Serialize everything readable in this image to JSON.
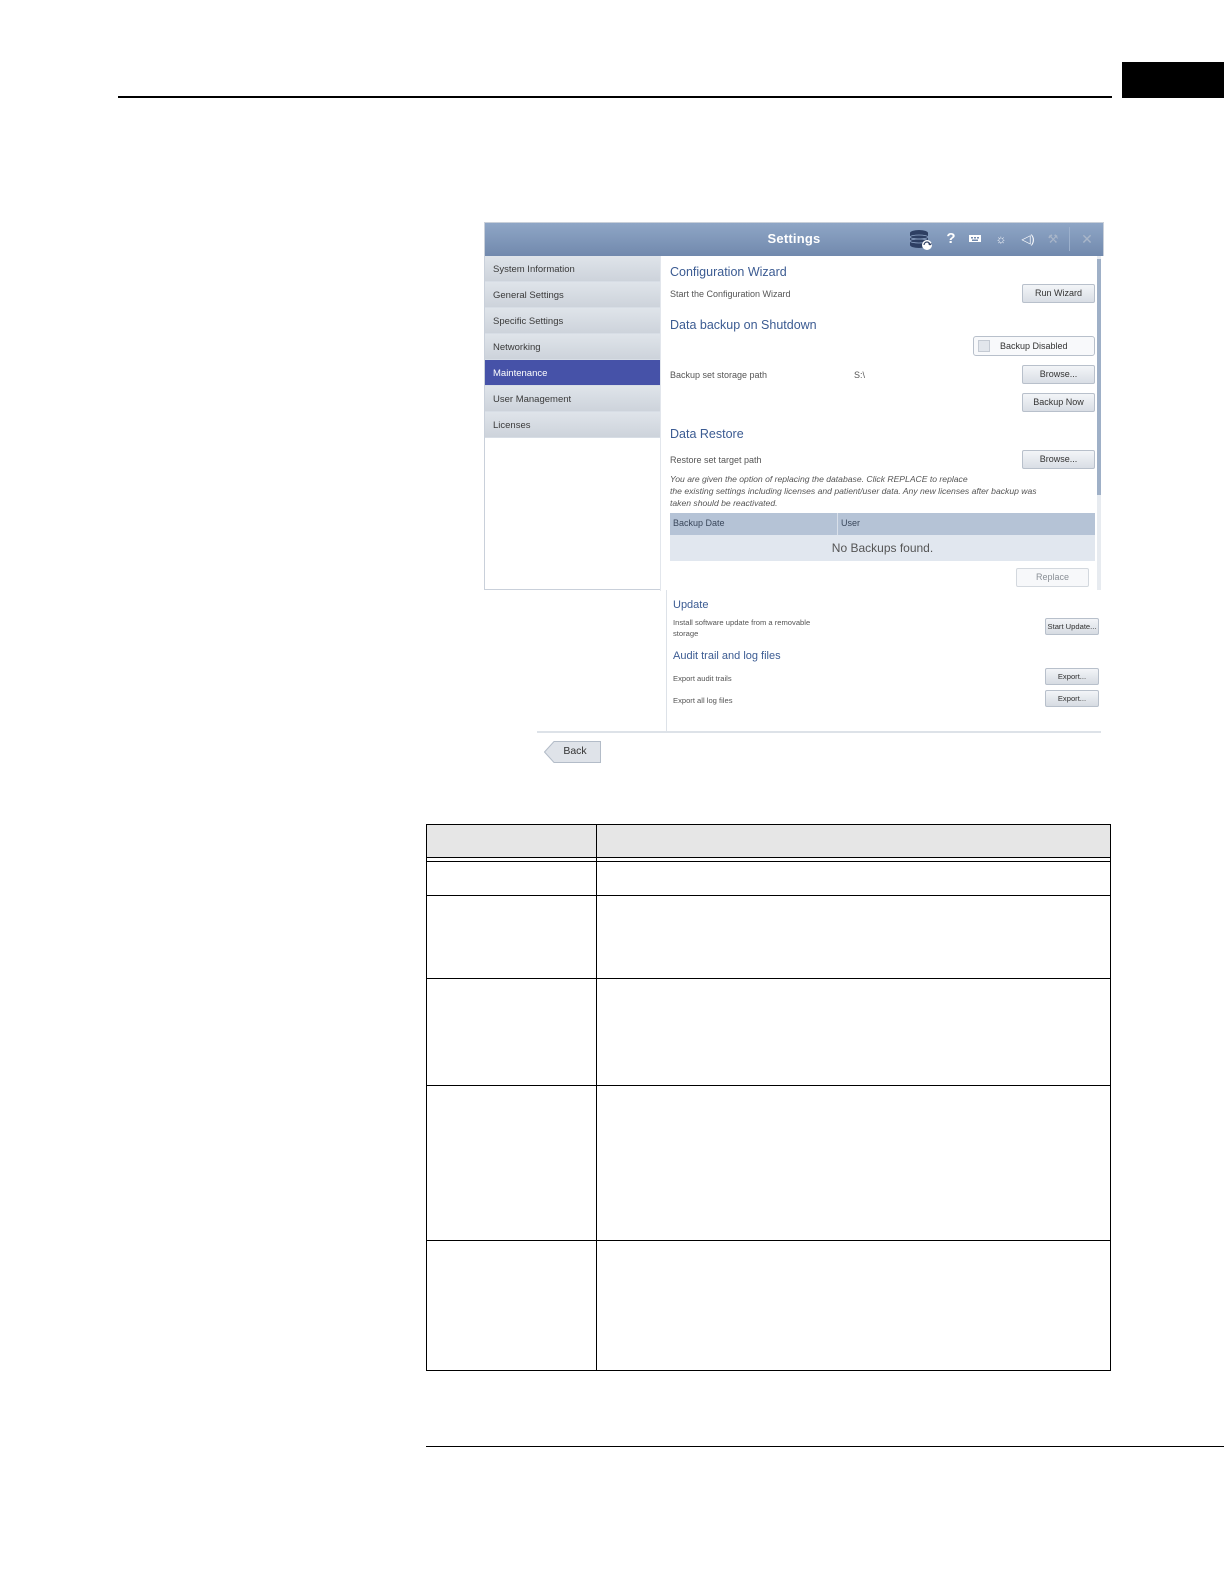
{
  "window": {
    "title": "Settings",
    "icons": [
      "database-sync-icon",
      "help-icon",
      "keyboard-icon",
      "brightness-icon",
      "volume-icon",
      "tool-icon",
      "close-icon"
    ],
    "help_glyph": "?"
  },
  "sidebar": {
    "items": [
      {
        "label": "System Information"
      },
      {
        "label": "General Settings"
      },
      {
        "label": "Specific Settings"
      },
      {
        "label": "Networking"
      },
      {
        "label": "Maintenance",
        "active": true
      },
      {
        "label": "User Management"
      },
      {
        "label": "Licenses"
      }
    ]
  },
  "config_wizard": {
    "heading": "Configuration Wizard",
    "label": "Start the Configuration Wizard",
    "button": "Run Wizard"
  },
  "backup": {
    "heading": "Data backup on Shutdown",
    "toggle_label": "Backup Disabled",
    "storage_path_label": "Backup set storage path",
    "storage_path_value": "S:\\",
    "browse_button": "Browse...",
    "backup_now_button": "Backup Now"
  },
  "restore": {
    "heading": "Data Restore",
    "target_path_label": "Restore set target path",
    "browse_button": "Browse...",
    "note_line1": "You are given the option of replacing the database. Click REPLACE to replace",
    "note_line2": "the existing settings including licenses and patient/user data. Any new licenses after backup was",
    "note_line3": "taken should be reactivated.",
    "table_headers": [
      "Backup Date",
      "User"
    ],
    "empty_text": "No Backups found.",
    "replace_button": "Replace"
  },
  "update": {
    "heading": "Update",
    "label_line1": "Install software update from a removable",
    "label_line2": "storage",
    "button": "Start Update..."
  },
  "audit": {
    "heading": "Audit trail and log files",
    "audit_label": "Export audit trails",
    "audit_button": "Export...",
    "log_label": "Export all log files",
    "log_button": "Export..."
  },
  "back_button": "Back",
  "colors": {
    "titlebar": "#7f97ba",
    "active_nav": "#4652a8",
    "heading": "#3b5b92",
    "table_header": "#b5c3d6"
  }
}
